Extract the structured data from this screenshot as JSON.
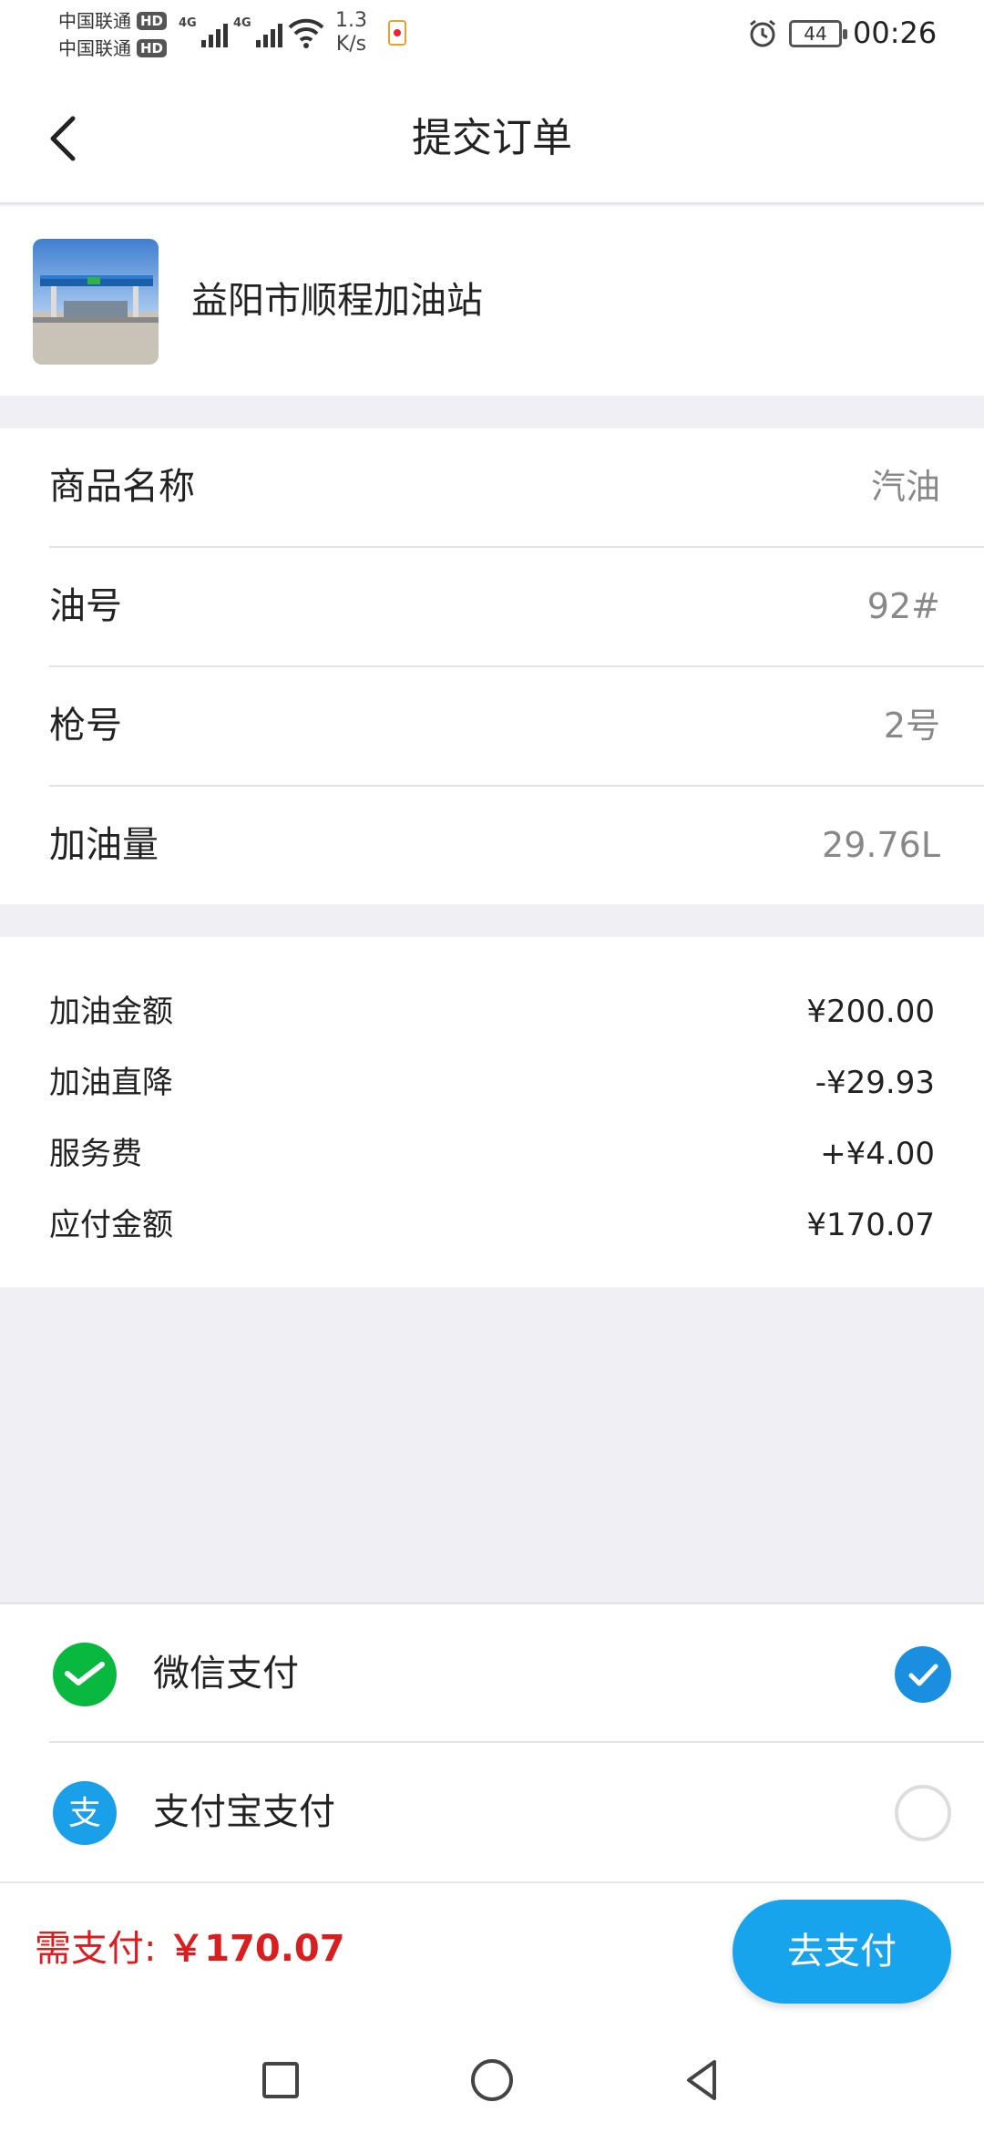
{
  "status_bar": {
    "carrier_1": "中国联通",
    "carrier_2": "中国联通",
    "hd_badge": "HD",
    "network_1": "4G",
    "network_2": "4G",
    "speed_value": "1.3",
    "speed_unit": "K/s",
    "battery": "44",
    "time": "00:26"
  },
  "header": {
    "title": "提交订单",
    "back_icon": "chevron-left-icon"
  },
  "station": {
    "name": "益阳市顺程加油站"
  },
  "product": {
    "rows": [
      {
        "label": "商品名称",
        "value": "汽油"
      },
      {
        "label": "油号",
        "value": "92#"
      },
      {
        "label": "枪号",
        "value": "2号"
      },
      {
        "label": "加油量",
        "value": "29.76L"
      }
    ]
  },
  "amounts": {
    "rows": [
      {
        "label": "加油金额",
        "value": "¥200.00"
      },
      {
        "label": "加油直降",
        "value": "-¥29.93"
      },
      {
        "label": "服务费",
        "value": "+¥4.00"
      },
      {
        "label": "应付金额",
        "value": "¥170.07"
      }
    ]
  },
  "payment": {
    "methods": [
      {
        "label": "微信支付",
        "icon": "wechat-pay-icon",
        "selected": true,
        "color": "#09b83e"
      },
      {
        "label": "支付宝支付",
        "icon": "alipay-icon",
        "selected": false,
        "color": "#1aa0e8"
      }
    ]
  },
  "bottom": {
    "total_label": "需支付:",
    "total_value": "￥170.07",
    "pay_button": "去支付",
    "accent": "#17a4ec",
    "total_color": "#d81e1e"
  },
  "navbar": {
    "recent_icon": "square-icon",
    "home_icon": "circle-icon",
    "back_icon": "triangle-back-icon"
  }
}
